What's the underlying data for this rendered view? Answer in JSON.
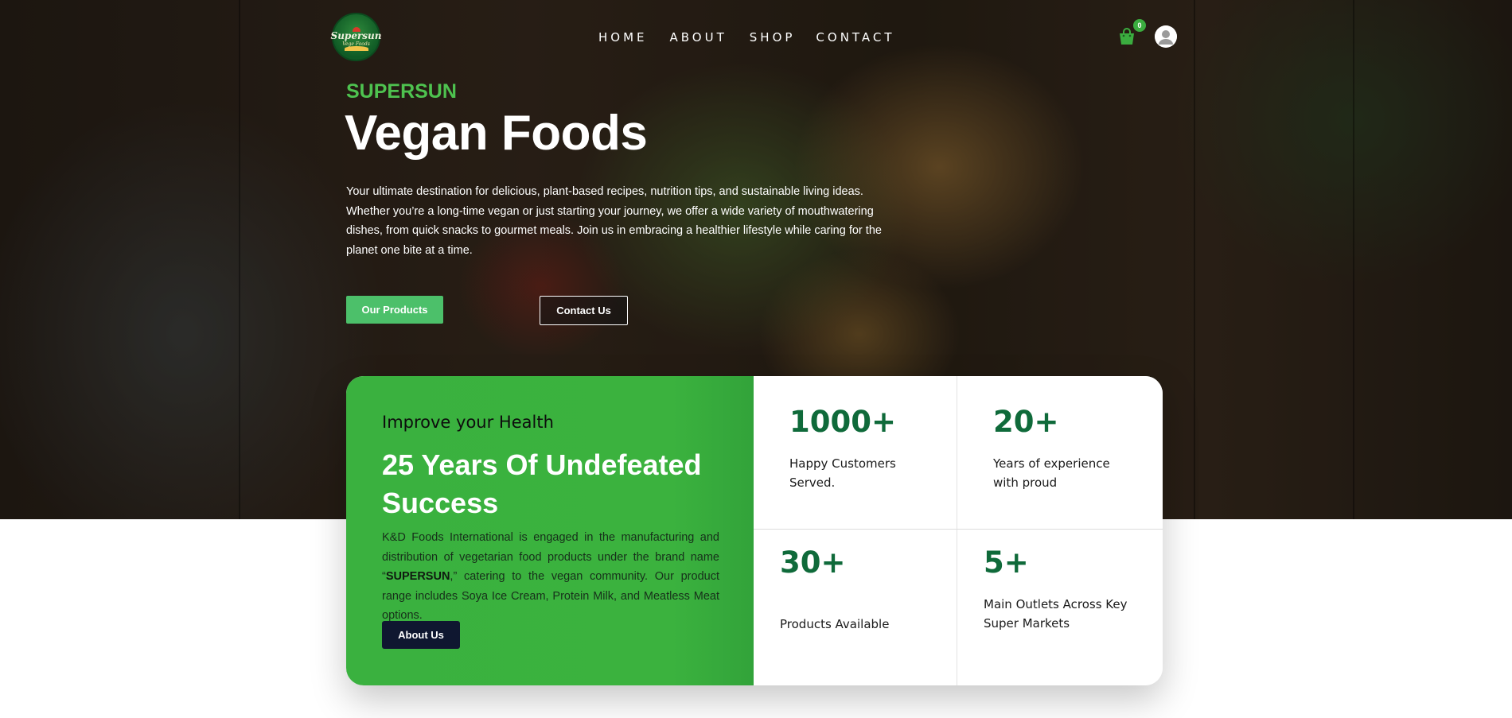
{
  "nav": {
    "logo_word": "Supersun",
    "logo_sub": "Vege Foods",
    "items": [
      {
        "label": "HOME"
      },
      {
        "label": "ABOUT"
      },
      {
        "label": "SHOP"
      },
      {
        "label": "CONTACT"
      }
    ],
    "cart_count": "0",
    "cart_icon": "shopping-bag-icon",
    "user_icon": "user-avatar-icon"
  },
  "hero": {
    "brand": "SUPERSUN",
    "headline": "Vegan Foods",
    "intro": "Your ultimate destination for delicious, plant-based recipes, nutrition tips, and sustainable living ideas. Whether you’re a long-time vegan or just starting your journey, we offer a wide variety of mouthwatering dishes, from quick snacks to gourmet meals. Join us in embracing a healthier lifestyle while caring for the planet one bite at a time.",
    "primary_button": "Our Products",
    "secondary_button": "Contact Us"
  },
  "about_card": {
    "kicker": "Improve your Health",
    "title": "25 Years Of Undefeated Success",
    "text_before": "K&D Foods International is engaged in the manufacturing and distribution of vegetarian food products under the brand name “",
    "text_brand": "SUPERSUN",
    "text_after": ",” catering to the vegan community. Our product range includes Soya Ice Cream, Protein Milk, and Meatless Meat options.",
    "button": "About Us"
  },
  "stats": [
    {
      "value": "1000+",
      "label": "Happy Customers Served."
    },
    {
      "value": "20+",
      "label": "Years of experience with proud"
    },
    {
      "value": "30+",
      "label": "Products Available"
    },
    {
      "value": "5+",
      "label": "Main Outlets Across Key Super Markets"
    }
  ],
  "colors": {
    "accent_green": "#3bb23e",
    "brand_green": "#4ec24f",
    "stat_green": "#0f6a3a",
    "navy": "#0f1730"
  }
}
